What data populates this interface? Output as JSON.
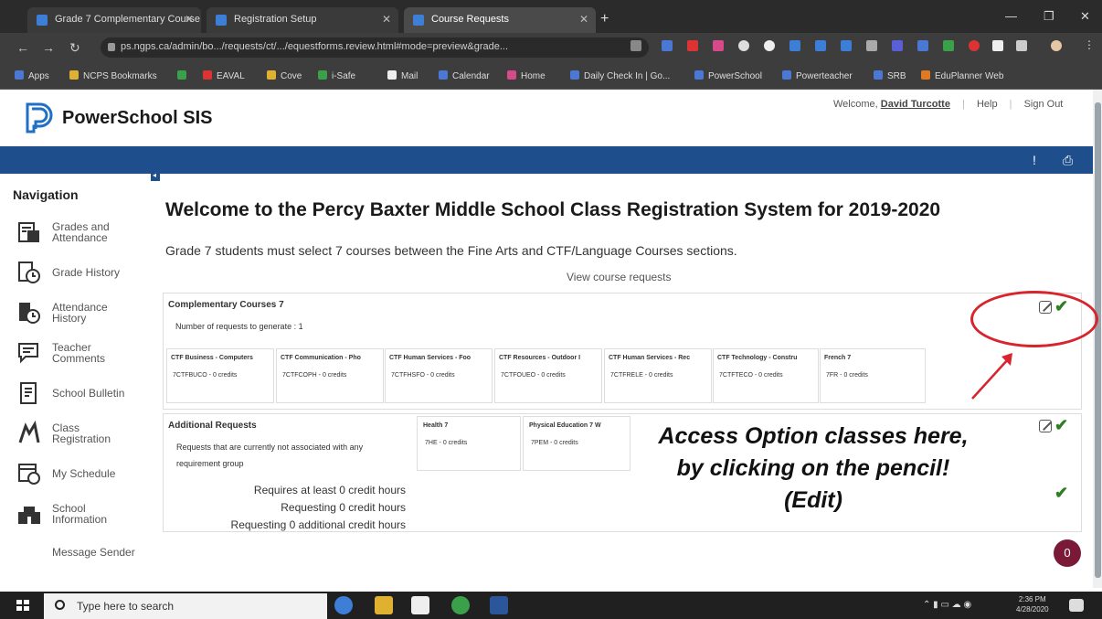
{
  "browser": {
    "tabs": [
      {
        "title": "Grade 7 Complementary Course"
      },
      {
        "title": "Registration Setup"
      },
      {
        "title": "Course Requests"
      }
    ],
    "url": "ps.ngps.ca/admin/bo.../requests/ct/.../equestforms.review.html#mode=preview&grade...",
    "bookmarks": [
      "Apps",
      "NCPS Bookmarks",
      "",
      "EAVAL",
      "Cove",
      "i-Safe",
      "Mail",
      "Calendar",
      "Home",
      "Daily Check In | Go...",
      "PowerSchool",
      "Powerteacher",
      "SRB",
      "EduPlanner Web"
    ]
  },
  "header": {
    "brand": "PowerSchool SIS",
    "welcome_label": "Welcome,",
    "user_name": "David Turcotte",
    "help": "Help",
    "sign_out": "Sign Out"
  },
  "nav": {
    "title": "Navigation",
    "items": [
      {
        "label": "Grades and Attendance",
        "icon": "grades-icon"
      },
      {
        "label": "Grade History",
        "icon": "grade-history-icon"
      },
      {
        "label": "Attendance History",
        "icon": "attendance-history-icon"
      },
      {
        "label": "Teacher Comments",
        "icon": "comments-icon"
      },
      {
        "label": "School Bulletin",
        "icon": "bulletin-icon"
      },
      {
        "label": "Class Registration",
        "icon": "registration-icon"
      },
      {
        "label": "My Schedule",
        "icon": "schedule-icon"
      },
      {
        "label": "School Information",
        "icon": "school-icon"
      },
      {
        "label": "Message Sender",
        "icon": "message-icon"
      }
    ]
  },
  "main": {
    "heading": "Welcome to the Percy Baxter Middle School Class Registration System for 2019-2020",
    "subheading": "Grade 7 students must select 7 courses between the Fine Arts and CTF/Language Courses sections.",
    "view_link": "View course requests",
    "complementary": {
      "title": "Complementary Courses 7",
      "requests_label": "Number of requests to generate : 1",
      "courses": [
        {
          "name": "CTF Business - Computers",
          "code": "7CTFBUCO - 0 credits"
        },
        {
          "name": "CTF Communication - Pho",
          "code": "7CTFCOPH - 0 credits"
        },
        {
          "name": "CTF Human Services - Foo",
          "code": "7CTFHSFO - 0 credits"
        },
        {
          "name": "CTF Resources - Outdoor I",
          "code": "7CTFOUEO - 0 credits"
        },
        {
          "name": "CTF Human Services - Rec",
          "code": "7CTFRELE - 0 credits"
        },
        {
          "name": "CTF Technology - Constru",
          "code": "7CTFTECO - 0 credits"
        },
        {
          "name": "French 7",
          "code": "7FR - 0 credits"
        }
      ]
    },
    "additional": {
      "title": "Additional Requests",
      "desc_line1": "Requests that are currently not associated with any",
      "desc_line2": "requirement group",
      "courses": [
        {
          "name": "Health 7",
          "code": "7HE - 0 credits"
        },
        {
          "name": "Physical Education 7 W",
          "code": "7PEM - 0 credits"
        }
      ]
    },
    "credits": {
      "line1": "Requires at least 0 credit hours",
      "line2": "Requesting 0 credit hours",
      "line3": "Requesting 0 additional credit hours"
    },
    "annotation": {
      "line1": "Access Option classes here,",
      "line2": "by clicking on the pencil!",
      "line3": "(Edit)"
    },
    "badge": "0"
  },
  "taskbar": {
    "search_placeholder": "Type here to search",
    "time": "2:36 PM",
    "date": "4/28/2020"
  },
  "colors": {
    "brand_blue": "#1f4e8d",
    "check_green": "#2f7d24",
    "annotation_red": "#d8242c",
    "badge": "#7a1a36"
  }
}
